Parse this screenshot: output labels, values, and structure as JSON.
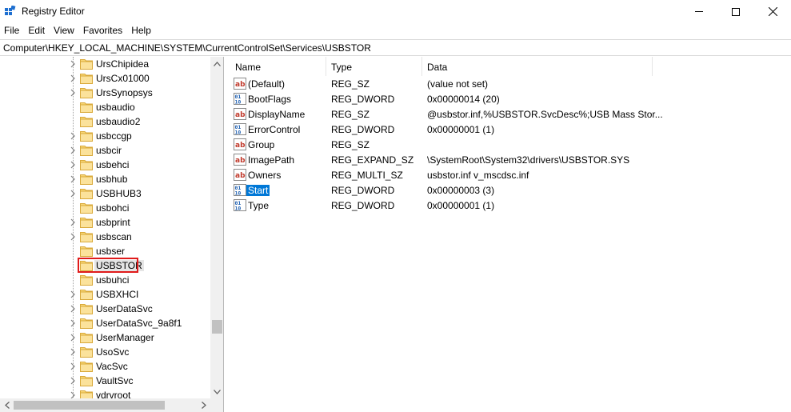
{
  "window": {
    "title": "Registry Editor",
    "icon": "regedit-icon"
  },
  "menu": [
    "File",
    "Edit",
    "View",
    "Favorites",
    "Help"
  ],
  "address": "Computer\\HKEY_LOCAL_MACHINE\\SYSTEM\\CurrentControlSet\\Services\\USBSTOR",
  "tree": {
    "selected": "USBSTOR",
    "items": [
      {
        "label": "UrsChipidea",
        "expandable": true
      },
      {
        "label": "UrsCx01000",
        "expandable": true
      },
      {
        "label": "UrsSynopsys",
        "expandable": true
      },
      {
        "label": "usbaudio",
        "expandable": false
      },
      {
        "label": "usbaudio2",
        "expandable": false
      },
      {
        "label": "usbccgp",
        "expandable": true
      },
      {
        "label": "usbcir",
        "expandable": true
      },
      {
        "label": "usbehci",
        "expandable": true
      },
      {
        "label": "usbhub",
        "expandable": true
      },
      {
        "label": "USBHUB3",
        "expandable": true
      },
      {
        "label": "usbohci",
        "expandable": false
      },
      {
        "label": "usbprint",
        "expandable": true
      },
      {
        "label": "usbscan",
        "expandable": true
      },
      {
        "label": "usbser",
        "expandable": false
      },
      {
        "label": "USBSTOR",
        "expandable": false
      },
      {
        "label": "usbuhci",
        "expandable": false
      },
      {
        "label": "USBXHCI",
        "expandable": true
      },
      {
        "label": "UserDataSvc",
        "expandable": true
      },
      {
        "label": "UserDataSvc_9a8f1",
        "expandable": true
      },
      {
        "label": "UserManager",
        "expandable": true
      },
      {
        "label": "UsoSvc",
        "expandable": true
      },
      {
        "label": "VacSvc",
        "expandable": true
      },
      {
        "label": "VaultSvc",
        "expandable": true
      },
      {
        "label": "vdrvroot",
        "expandable": true
      }
    ]
  },
  "values_pane": {
    "columns": {
      "name": "Name",
      "type": "Type",
      "data": "Data"
    },
    "selected": "Start",
    "rows": [
      {
        "name": "(Default)",
        "type": "REG_SZ",
        "data": "(value not set)",
        "icon": "string-value-icon"
      },
      {
        "name": "BootFlags",
        "type": "REG_DWORD",
        "data": "0x00000014 (20)",
        "icon": "binary-value-icon"
      },
      {
        "name": "DisplayName",
        "type": "REG_SZ",
        "data": "@usbstor.inf,%USBSTOR.SvcDesc%;USB Mass Stor...",
        "icon": "string-value-icon"
      },
      {
        "name": "ErrorControl",
        "type": "REG_DWORD",
        "data": "0x00000001 (1)",
        "icon": "binary-value-icon"
      },
      {
        "name": "Group",
        "type": "REG_SZ",
        "data": "",
        "icon": "string-value-icon"
      },
      {
        "name": "ImagePath",
        "type": "REG_EXPAND_SZ",
        "data": "\\SystemRoot\\System32\\drivers\\USBSTOR.SYS",
        "icon": "string-value-icon"
      },
      {
        "name": "Owners",
        "type": "REG_MULTI_SZ",
        "data": "usbstor.inf v_mscdsc.inf",
        "icon": "string-value-icon"
      },
      {
        "name": "Start",
        "type": "REG_DWORD",
        "data": "0x00000003 (3)",
        "icon": "binary-value-icon"
      },
      {
        "name": "Type",
        "type": "REG_DWORD",
        "data": "0x00000001 (1)",
        "icon": "binary-value-icon"
      }
    ]
  },
  "colors": {
    "selection_blue": "#0078d7",
    "highlight_red": "#e01b1b",
    "folder_yellow": "#f8d775"
  }
}
